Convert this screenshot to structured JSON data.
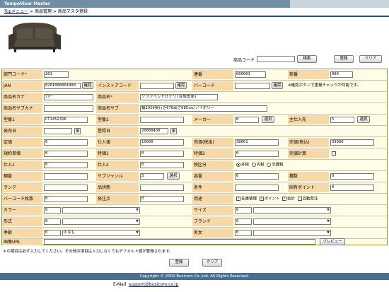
{
  "app": {
    "title": "TempoVisor Master"
  },
  "breadcrumb": {
    "home": "Topメニュー",
    "sep1": " > ",
    "level1": "商品管理",
    "sep2": " > ",
    "current": "商品マスタ登録"
  },
  "search": {
    "code_label": "商品コード",
    "code_value": "",
    "search_btn": "検索",
    "register_btn": "登録",
    "clear_btn": "クリア"
  },
  "form": {
    "dept_label": "部門コード",
    "dept_req": "*",
    "dept_value": "201",
    "serial_label": "連番",
    "serial_value": "000001",
    "branch_label": "枝番",
    "branch_value": "000",
    "jan_label": "JAN",
    "jan_value": "0201000001000",
    "confirm_btn": "確認",
    "instore_label": "インストアコード",
    "instore_value": "",
    "barcode_label": "バーコード",
    "barcode_value": "",
    "confirm_note": "※確認ボタンで重複チェックが可能です。",
    "kana_label": "商品名カナ",
    "kana_value": "ｿﾌｧｰ",
    "name_label": "商品名",
    "name_req": "*",
    "name_value": "ソファベッドＢデリ(合成皮革)",
    "subkana_label": "商品名サブカナ",
    "subkana_value": "",
    "sub_label": "商品名サブ",
    "sub_value": "幅1920奥行き670高さ685cm/アイボリー",
    "model1_label": "型番1",
    "model1_value": "CT1452326",
    "model2_label": "型番2",
    "model2_value": "",
    "maker_label": "メーカー",
    "maker_value": "0",
    "select_btn": "選択",
    "supplier_label": "主仕入先",
    "supplier_value": "5",
    "release_label": "発売日",
    "release_value": "",
    "regdate_label": "登録日",
    "regdate_value": "20080430",
    "standard_price_label": "定価",
    "standard_price_value": "0",
    "cost_label": "仕入値",
    "cost_value": "15000",
    "sell_notax_label": "売価(税抜)",
    "sell_notax_value": "38001",
    "sell_tax_label": "売価(税込)",
    "sell_tax_value": "39900",
    "prev_price_label": "規約単価",
    "prev_price_value": "0",
    "special1_label": "特価1",
    "special1_value": "0",
    "special2_label": "特価2",
    "special2_value": "0",
    "sell_calc_label": "売価計算",
    "cost1_label": "仕入1",
    "cost1_value": "0",
    "cost2_label": "仕入2",
    "cost2_value": "0",
    "tax_label": "税区分",
    "tax_opt1": "外税",
    "tax_opt2": "内税",
    "tax_opt3": "非課税",
    "shelf_label": "棚番",
    "shelf_value": "",
    "subgenre_label": "サブジャンル",
    "subgenre_value": "3",
    "capacity_label": "容量",
    "capacity_value": "0",
    "count_label": "種数",
    "count_value": "0",
    "rank_label": "ランク",
    "rank_value": "",
    "status_label": "品状態",
    "status_value": "",
    "condition_label": "条件",
    "condition_value": "",
    "point_label": "固有ポイント",
    "point_value": "0",
    "barcode_count_label": "バーコード枚数",
    "barcode_count_value": "0",
    "order_point_label": "発注点",
    "order_point_value": "0",
    "use_label": "用途",
    "use_opt1": "在庫管理",
    "use_opt2": "ポイント",
    "use_opt3": "会計",
    "use_opt4": "自動発注",
    "color_label": "カラー",
    "color_value": "0",
    "size_label": "サイズ",
    "size_value": "0",
    "form_label": "形式",
    "form_value": "0",
    "brand_label": "ブランド",
    "brand_value": "0",
    "season_label": "季節",
    "season_value": "0",
    "season_select": "0:なし",
    "gender_label": "男女",
    "gender_value": "0",
    "image_label": "画像URL",
    "image_value": "",
    "preview_btn": "プレビュー"
  },
  "notes": {
    "required_note": "＊の項目は必ず入力してください。その他の項目は入力しなくてもデフォルト値が登録されます。"
  },
  "actions": {
    "register_btn": "登録",
    "clear_btn": "クリア"
  },
  "footer": {
    "copyright": "Copyright © 2002 Busicom Co.,Ltd. All Rights Reserved.",
    "email_label": "E-Mail",
    "email": "support@busicom.co.jp"
  }
}
